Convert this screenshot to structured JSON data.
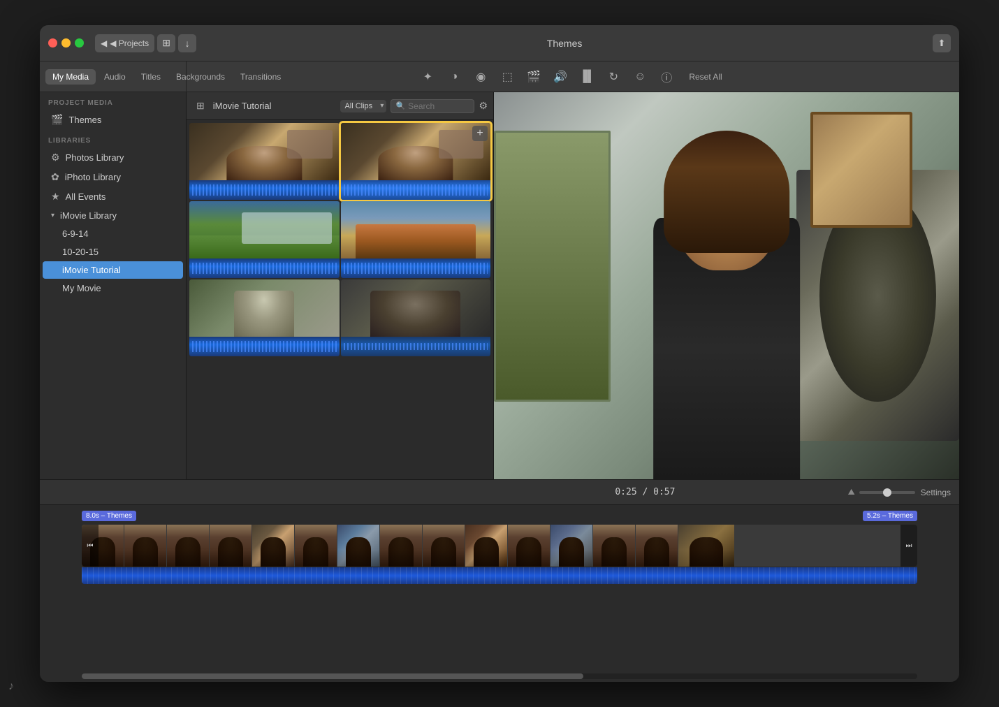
{
  "window": {
    "title": "Themes",
    "share_label": "⬆"
  },
  "titlebar": {
    "back_label": "◀ Projects",
    "grid_label": "⊞",
    "down_label": "↓"
  },
  "top_tabs": {
    "my_media": "My Media",
    "audio": "Audio",
    "titles": "Titles",
    "backgrounds": "Backgrounds",
    "transitions": "Transitions"
  },
  "edit_tools": {
    "magic_wand": "✦",
    "contrast": "◑",
    "color": "◉",
    "crop": "⬚",
    "camera": "⬛",
    "audio": "◎",
    "bars": "≡",
    "rotation": "↺",
    "face": "☺",
    "info": "ⓘ",
    "reset_all": "Reset All"
  },
  "sidebar": {
    "project_media_label": "PROJECT MEDIA",
    "themes_label": "Themes",
    "libraries_label": "LIBRARIES",
    "photos_library": "Photos Library",
    "iphoto_library": "iPhoto Library",
    "all_events": "All Events",
    "imovie_library": "iMovie Library",
    "date_1": "6-9-14",
    "date_2": "10-20-15",
    "imovie_tutorial": "iMovie Tutorial",
    "my_movie": "My Movie"
  },
  "media_panel": {
    "title": "iMovie Tutorial",
    "filter": "All Clips",
    "search_placeholder": "Search"
  },
  "timeline": {
    "time_current": "0:25",
    "time_total": "0:57",
    "settings_label": "Settings",
    "theme_left": "8.0s – Themes",
    "theme_right": "5.2s – Themes"
  }
}
